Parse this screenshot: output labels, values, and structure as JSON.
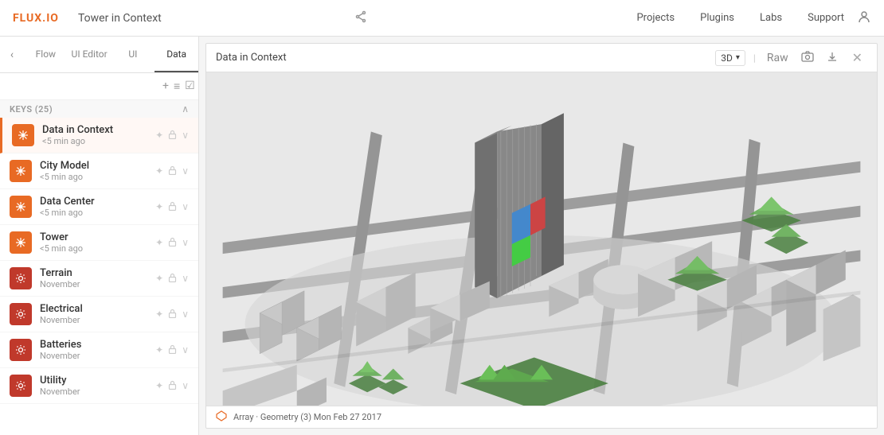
{
  "app": {
    "logo_prefix": "FLUX",
    "logo_suffix": ".IO",
    "project_title": "Tower in Context",
    "share_icon": "⊕"
  },
  "nav": {
    "links": [
      "Projects",
      "Plugins",
      "Labs",
      "Support"
    ],
    "user_icon": "👤"
  },
  "sidebar": {
    "back_arrow": "‹",
    "tabs": [
      "Flow",
      "UI Editor",
      "UI",
      "Data"
    ],
    "active_tab": "Data",
    "search_placeholder": "",
    "add_icon": "+",
    "filter_icon": "≡",
    "check_icon": "☑",
    "keys_label": "KEYS (25)",
    "collapse_icon": "∧",
    "keys": [
      {
        "name": "Data in Context",
        "time": "<5 min ago",
        "icon_type": "snowflake",
        "color": "orange",
        "active": true
      },
      {
        "name": "City Model",
        "time": "<5 min ago",
        "icon_type": "snowflake",
        "color": "orange",
        "active": false
      },
      {
        "name": "Data Center",
        "time": "<5 min ago",
        "icon_type": "snowflake",
        "color": "orange",
        "active": false
      },
      {
        "name": "Tower",
        "time": "<5 min ago",
        "icon_type": "snowflake",
        "color": "orange",
        "active": false
      },
      {
        "name": "Terrain",
        "time": "November",
        "icon_type": "gear",
        "color": "red-dark",
        "active": false
      },
      {
        "name": "Electrical",
        "time": "November",
        "icon_type": "gear",
        "color": "red-dark",
        "active": false
      },
      {
        "name": "Batteries",
        "time": "November",
        "icon_type": "gear",
        "color": "red-dark",
        "active": false
      },
      {
        "name": "Utility",
        "time": "November",
        "icon_type": "gear",
        "color": "red-dark",
        "active": false
      }
    ],
    "key_pin_icon": "✦",
    "key_lock_icon": "🔒",
    "key_chevron": "∨"
  },
  "viewer": {
    "title": "Data in Context",
    "view_mode": "3D",
    "view_arrow": "∨",
    "raw_label": "Raw",
    "separator": "|",
    "camera_icon": "◎",
    "download_icon": "⬇",
    "close_icon": "✕",
    "footer_icon": "❋",
    "footer_text": "Array · Geometry (3)  Mon Feb 27 2017"
  }
}
